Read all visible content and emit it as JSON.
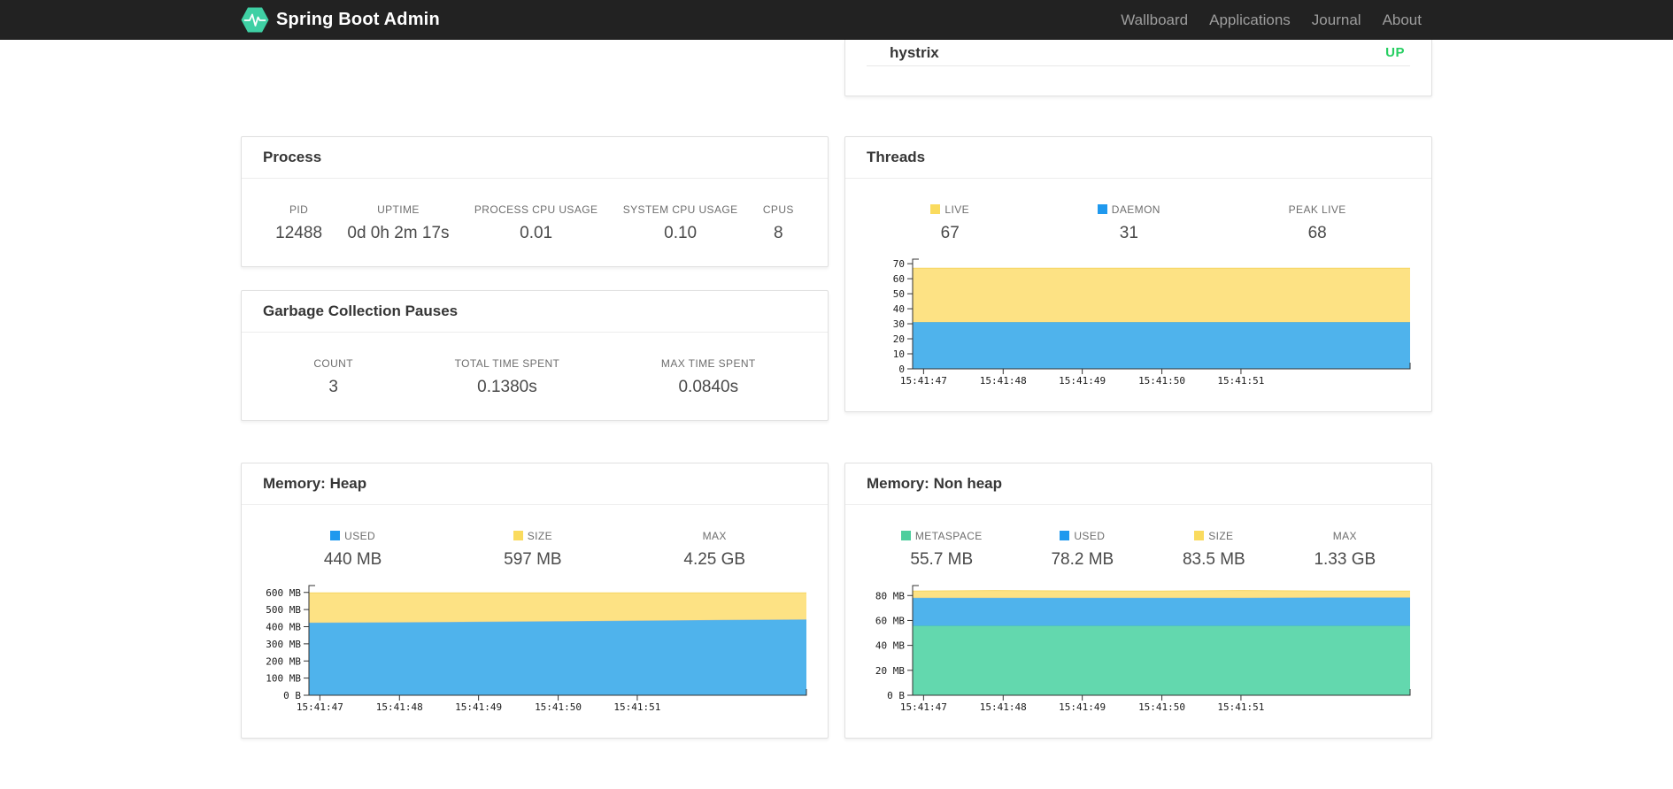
{
  "navbar": {
    "brand": "Spring Boot Admin",
    "items": [
      {
        "label": "Wallboard"
      },
      {
        "label": "Applications"
      },
      {
        "label": "Journal"
      },
      {
        "label": "About"
      }
    ]
  },
  "colors": {
    "brand_green": "#3fd0a4",
    "navbar_bg": "#222222",
    "status_up": "#26ce61",
    "series_blue_fill": "#4FB3EC",
    "series_blue_accent": "#1F99EE",
    "series_yellow_fill": "#FDE284",
    "series_yellow_accent": "#FADB5E",
    "series_green_fill": "#63D8AE",
    "series_green_accent": "#4ECE9D"
  },
  "health_card": {
    "row_label": "hystrix",
    "row_status": "UP"
  },
  "cards": {
    "process": {
      "title": "Process",
      "stats": [
        {
          "label": "PID",
          "value": "12488"
        },
        {
          "label": "UPTIME",
          "value": "0d 0h 2m 17s"
        },
        {
          "label": "PROCESS CPU USAGE",
          "value": "0.01"
        },
        {
          "label": "SYSTEM CPU USAGE",
          "value": "0.10"
        },
        {
          "label": "CPUS",
          "value": "8"
        }
      ]
    },
    "gc": {
      "title": "Garbage Collection Pauses",
      "stats": [
        {
          "label": "COUNT",
          "value": "3"
        },
        {
          "label": "TOTAL TIME SPENT",
          "value": "0.1380s"
        },
        {
          "label": "MAX TIME SPENT",
          "value": "0.0840s"
        }
      ]
    },
    "threads": {
      "title": "Threads",
      "stats": [
        {
          "label": "LIVE",
          "value": "67",
          "swatch": "#FADB5E"
        },
        {
          "label": "DAEMON",
          "value": "31",
          "swatch": "#1F99EE"
        },
        {
          "label": "PEAK LIVE",
          "value": "68"
        }
      ]
    },
    "heap": {
      "title": "Memory: Heap",
      "stats": [
        {
          "label": "USED",
          "value": "440 MB",
          "swatch": "#1F99EE"
        },
        {
          "label": "SIZE",
          "value": "597 MB",
          "swatch": "#FADB5E"
        },
        {
          "label": "MAX",
          "value": "4.25 GB"
        }
      ]
    },
    "nonheap": {
      "title": "Memory: Non heap",
      "stats": [
        {
          "label": "METASPACE",
          "value": "55.7 MB",
          "swatch": "#4ECE9D"
        },
        {
          "label": "USED",
          "value": "78.2 MB",
          "swatch": "#1F99EE"
        },
        {
          "label": "SIZE",
          "value": "83.5 MB",
          "swatch": "#FADB5E"
        },
        {
          "label": "MAX",
          "value": "1.33 GB"
        }
      ]
    }
  },
  "chart_data": [
    {
      "id": "threads",
      "type": "area",
      "title": "Threads",
      "stacking": "cumulative-tops",
      "grid": false,
      "legend_position": "top-stats",
      "x_labels": [
        "15:41:47",
        "15:41:48",
        "15:41:49",
        "15:41:50",
        "15:41:51"
      ],
      "x_tick_fractions": [
        0.022,
        0.182,
        0.341,
        0.501,
        0.66
      ],
      "ylim": [
        0,
        73
      ],
      "y_ticks": [
        [
          0,
          "0"
        ],
        [
          10,
          "10"
        ],
        [
          20,
          "20"
        ],
        [
          30,
          "30"
        ],
        [
          40,
          "40"
        ],
        [
          50,
          "50"
        ],
        [
          60,
          "60"
        ],
        [
          70,
          "70"
        ]
      ],
      "series": [
        {
          "name": "DAEMON",
          "fill": "#4FB3EC",
          "stroke": "#2EA3E4",
          "values": [
            31,
            31,
            31,
            31,
            31,
            31,
            31
          ]
        },
        {
          "name": "LIVE",
          "fill": "#FDE284",
          "stroke": "#F6D663",
          "values": [
            67,
            67,
            67,
            67,
            67,
            67,
            67
          ]
        }
      ]
    },
    {
      "id": "heap",
      "type": "area",
      "title": "Memory: Heap",
      "stacking": "cumulative-tops",
      "grid": false,
      "legend_position": "top-stats",
      "x_labels": [
        "15:41:47",
        "15:41:48",
        "15:41:49",
        "15:41:50",
        "15:41:51"
      ],
      "x_tick_fractions": [
        0.022,
        0.182,
        0.341,
        0.501,
        0.66
      ],
      "ylim": [
        0,
        640
      ],
      "y_ticks": [
        [
          0,
          "0 B"
        ],
        [
          100,
          "100 MB"
        ],
        [
          200,
          "200 MB"
        ],
        [
          300,
          "300 MB"
        ],
        [
          400,
          "400 MB"
        ],
        [
          500,
          "500 MB"
        ],
        [
          600,
          "600 MB"
        ]
      ],
      "series": [
        {
          "name": "USED",
          "fill": "#4FB3EC",
          "stroke": "#8FB6C9",
          "values": [
            424,
            426,
            429,
            432,
            436,
            440,
            443
          ]
        },
        {
          "name": "SIZE",
          "fill": "#FDE284",
          "stroke": "#F6D663",
          "values": [
            597,
            597,
            597,
            597,
            597,
            597,
            597
          ]
        }
      ]
    },
    {
      "id": "nonheap",
      "type": "area",
      "title": "Memory: Non heap",
      "stacking": "cumulative-tops",
      "grid": false,
      "legend_position": "top-stats",
      "x_labels": [
        "15:41:47",
        "15:41:48",
        "15:41:49",
        "15:41:50",
        "15:41:51"
      ],
      "x_tick_fractions": [
        0.022,
        0.182,
        0.341,
        0.501,
        0.66
      ],
      "ylim": [
        0,
        88
      ],
      "y_ticks": [
        [
          0,
          "0 B"
        ],
        [
          20,
          "20 MB"
        ],
        [
          40,
          "40 MB"
        ],
        [
          60,
          "60 MB"
        ],
        [
          80,
          "80 MB"
        ]
      ],
      "series": [
        {
          "name": "METASPACE",
          "fill": "#63D8AE",
          "stroke": "#4ECE9D",
          "values": [
            55.7,
            55.7,
            55.7,
            55.7,
            55.7,
            55.7,
            55.7
          ]
        },
        {
          "name": "USED",
          "fill": "#4FB3EC",
          "stroke": "#8FB6C9",
          "values": [
            78.2,
            78.2,
            78.2,
            78.2,
            78.2,
            78.5,
            78.5
          ]
        },
        {
          "name": "SIZE",
          "fill": "#FDE284",
          "stroke": "#F6D663",
          "values": [
            83.5,
            84,
            83.7,
            83.5,
            84,
            83.5,
            83.5
          ]
        }
      ]
    }
  ]
}
